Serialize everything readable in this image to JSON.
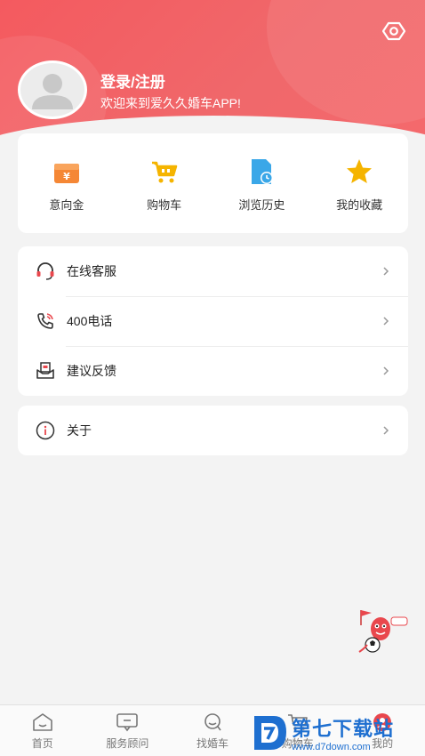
{
  "header": {
    "login_title": "登录/注册",
    "welcome_text": "欢迎来到爱久久婚车APP!",
    "settings_icon": "settings-hexagon-icon",
    "accent": "#f45a5f"
  },
  "quick_actions": [
    {
      "label": "意向金",
      "icon": "money-box-icon",
      "color": "#f58735"
    },
    {
      "label": "购物车",
      "icon": "shopping-cart-icon",
      "color": "#f5b400"
    },
    {
      "label": "浏览历史",
      "icon": "history-doc-icon",
      "color": "#3aa7e8"
    },
    {
      "label": "我的收藏",
      "icon": "star-icon",
      "color": "#f5b400"
    }
  ],
  "menu": [
    {
      "label": "在线客服",
      "icon": "headset-icon"
    },
    {
      "label": "400电话",
      "icon": "phone-icon"
    },
    {
      "label": "建议反馈",
      "icon": "feedback-icon"
    }
  ],
  "about": {
    "label": "关于",
    "icon": "info-icon"
  },
  "tabbar": [
    {
      "label": "首页",
      "icon": "home-icon"
    },
    {
      "label": "服务顾问",
      "icon": "chat-icon"
    },
    {
      "label": "找婚车",
      "icon": "search-icon"
    },
    {
      "label": "购物车",
      "icon": "cart-icon"
    },
    {
      "label": "我的",
      "icon": "profile-icon"
    }
  ],
  "watermark": {
    "title": "第七下载站",
    "url": "www.d7down.com"
  }
}
